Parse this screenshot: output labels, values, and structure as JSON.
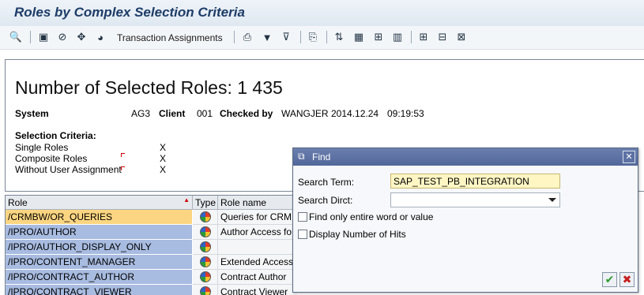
{
  "window": {
    "title": "Roles by Complex Selection Criteria"
  },
  "toolbar": {
    "transaction_assignments_label": "Transaction Assignments",
    "icons": [
      "search-icon",
      "details-icon",
      "delete-icon",
      "move-icon",
      "role-icon",
      "print-icon",
      "filter-icon",
      "set-filter-icon",
      "export-icon",
      "sort-icon",
      "calculator-icon",
      "subtotal-icon",
      "graphic-icon",
      "layout-icon",
      "change-layout-icon",
      "save-layout-icon"
    ]
  },
  "report": {
    "heading": "Number of Selected Roles: 1 435",
    "system_label": "System",
    "system_value": "AG3",
    "client_label": "Client",
    "client_value": "001",
    "checked_by_label": "Checked by",
    "checked_by_value": "WANGJER",
    "date": "2014.12.24",
    "time": "09:19:53",
    "criteria_title": "Selection Criteria:",
    "criteria": [
      {
        "label": "Single Roles",
        "value": "X"
      },
      {
        "label": "Composite Roles",
        "value": "X"
      },
      {
        "label": "Without User Assignment",
        "value": "X"
      }
    ]
  },
  "table": {
    "columns": {
      "role": "Role",
      "type": "Type",
      "role_name": "Role name"
    },
    "rows": [
      {
        "role": "/CRMBW/OR_QUERIES",
        "name": "Queries for CRM",
        "selected": true
      },
      {
        "role": "/IPRO/AUTHOR",
        "name": "Author Access fo",
        "selected": false
      },
      {
        "role": "/IPRO/AUTHOR_DISPLAY_ONLY",
        "name": "",
        "selected": false
      },
      {
        "role": "/IPRO/CONTENT_MANAGER",
        "name": "Extended Access",
        "selected": false
      },
      {
        "role": "/IPRO/CONTRACT_AUTHOR",
        "name": "Contract Author",
        "selected": false
      },
      {
        "role": "/IPRO/CONTRACT_VIEWER",
        "name": "Contract Viewer",
        "selected": false
      }
    ]
  },
  "dialog": {
    "title": "Find",
    "close_label": "✕",
    "search_term_label": "Search Term:",
    "search_term_value": "SAP_TEST_PB_INTEGRATION",
    "search_dirct_label": "Search Dirct:",
    "search_dirct_value": "",
    "entire_word_label": "Find only entire word or value",
    "display_hits_label": "Display Number of Hits",
    "ok_label": "✔",
    "cancel_label": "✖",
    "ok_color": "#2e9a2e",
    "cancel_color": "#c62020"
  }
}
